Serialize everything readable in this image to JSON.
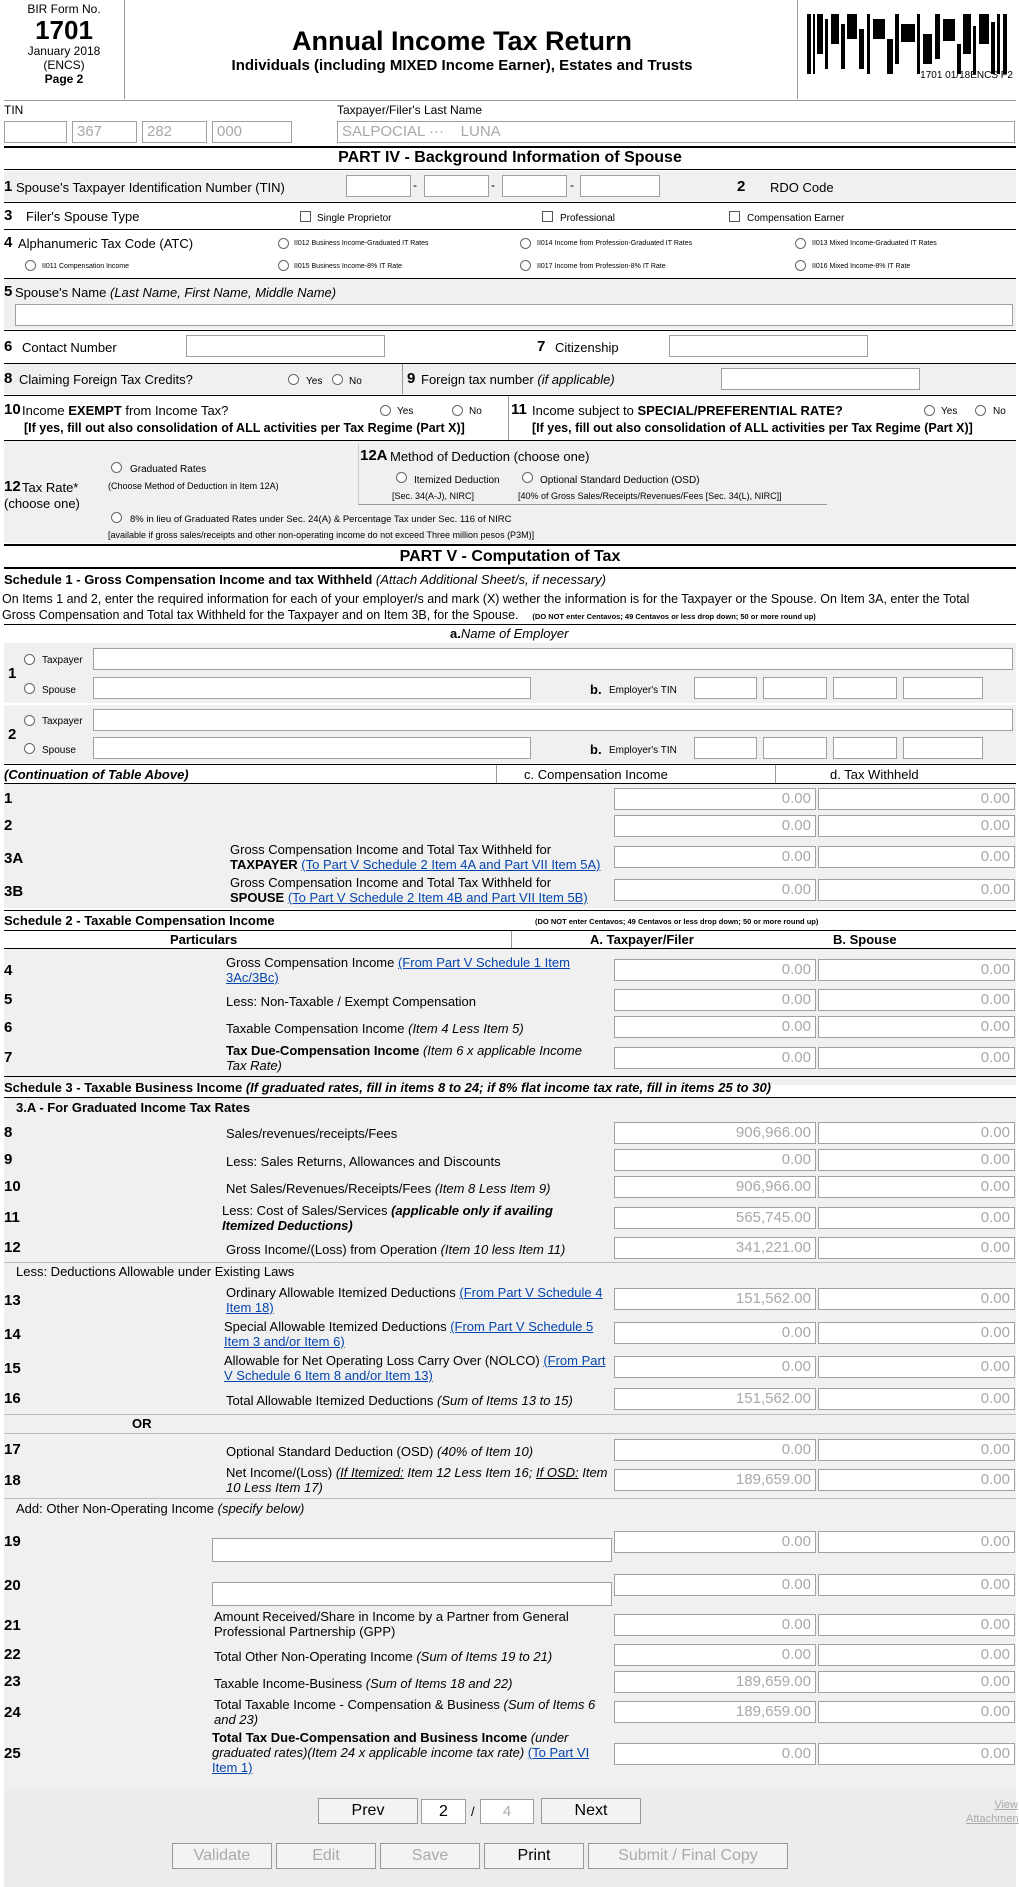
{
  "header": {
    "bir_form_no_label": "BIR Form No.",
    "form_number": "1701",
    "form_date": "January 2018",
    "form_encs": "(ENCS)",
    "page_label": "Page 2",
    "title": "Annual Income Tax Return",
    "subtitle": "Individuals (including MIXED Income Earner), Estates and Trusts",
    "barcode_text": "1701 01/18ENCS P2"
  },
  "tin_row": {
    "tin_label": "TIN",
    "tin_parts": [
      "",
      "367",
      "282",
      "000"
    ],
    "lastname_label": "Taxpayer/Filer's Last Name",
    "lastname_value": "SALPOCIAL ···    LUNA"
  },
  "part4": {
    "title": "PART IV - Background Information of Spouse",
    "item1_num": "1",
    "item1_label": "Spouse's Taxpayer Identification Number (TIN)",
    "item2_num": "2",
    "item2_label": "RDO Code",
    "item3_num": "3",
    "item3_label": "Filer's Spouse Type",
    "spouse_types": [
      "Single Proprietor",
      "Professional",
      "Compensation Earner"
    ],
    "item4_num": "4",
    "item4_label": "Alphanumeric Tax Code (ATC)",
    "atc_options": [
      "II012 Business Income-Graduated IT Rates",
      "II014 Income from Profession-Graduated IT Rates",
      "II013 Mixed Income-Graduated IT Rates",
      "II011 Compensation Income",
      "II015 Business Income-8% IT Rate",
      "II017 Income from Profession-8% IT Rate",
      "II016 Mixed Income-8% IT Rate"
    ],
    "item5_num": "5",
    "item5_label": "Spouse's Name",
    "item5_hint": "(Last Name, First Name, Middle Name)",
    "item6_num": "6",
    "item6_label": "Contact Number",
    "item7_num": "7",
    "item7_label": "Citizenship",
    "item8_num": "8",
    "item8_label": "Claiming Foreign Tax Credits?",
    "yes_label": "Yes",
    "no_label": "No",
    "item9_num": "9",
    "item9_label": "Foreign tax number",
    "item9_hint": "(if applicable)",
    "item10_num": "10",
    "item10_label_a": "Income ",
    "item10_label_b": "EXEMPT",
    "item10_label_c": " from Income Tax?",
    "item10_note": "[If yes, fill out also consolidation of ALL activities per Tax Regime (Part X)]",
    "item11_num": "11",
    "item11_label_a": "Income subject to ",
    "item11_label_b": "SPECIAL/PREFERENTIAL RATE?",
    "item11_note": "[If yes, fill out also consolidation of ALL activities per Tax Regime (Part X)]",
    "item12_num": "12",
    "item12_label": "Tax Rate*",
    "item12_choose": "(choose one)",
    "graduated_label": "Graduated Rates",
    "graduated_note": "(Choose Method of Deduction in Item 12A)",
    "eight_label": "8% in lieu of Graduated Rates under Sec. 24(A) & Percentage Tax under Sec. 116 of NIRC",
    "eight_note": "[available if gross sales/receipts and other non-operating income do not exceed Three million pesos (P3M)]",
    "item12a_num": "12A",
    "item12a_label": "Method of Deduction (choose one)",
    "itemized_label": "Itemized Deduction",
    "itemized_note": "[Sec. 34(A-J), NIRC]",
    "osd_label": "Optional Standard Deduction (OSD)",
    "osd_note": "[40% of Gross Sales/Receipts/Revenues/Fees [Sec. 34(L), NIRC]]"
  },
  "part5": {
    "title": "PART V - Computation of Tax",
    "sched1_title": "Schedule 1 - Gross Compensation Income and tax Withheld",
    "sched1_hint": "(Attach Additional Sheet/s, if necessary)",
    "sched1_instr": "On Items 1 and 2, enter the required information for each of your employer/s and mark (X) wether the information is for the Taxpayer or the Spouse. On Item 3A, enter the Total Gross Compensation and Total tax Withheld for the Taxpayer and on Item 3B, for the Spouse.",
    "sched1_centavos": "(DO NOT enter Centavos; 49 Centavos or less drop down; 50 or more round up)",
    "col_a_prefix": "a.",
    "col_a_label": "Name of Employer",
    "taxpayer_label": "Taxpayer",
    "spouse_label": "Spouse",
    "b_prefix": "b.",
    "employer_tin_label": "Employer's TIN",
    "cont_label": "(Continuation of Table Above)",
    "col_c_label": "c. Compensation Income",
    "col_d_label": "d. Tax Withheld",
    "s1_rows": [
      {
        "num": "1",
        "label": "",
        "c": "0.00",
        "d": "0.00"
      },
      {
        "num": "2",
        "label": "",
        "c": "0.00",
        "d": "0.00"
      },
      {
        "num": "3A",
        "label": "Gross Compensation Income and Total Tax Withheld for",
        "label2": "TAXPAYER",
        "link": "(To Part V Schedule 2 Item 4A and Part VII Item 5A)",
        "c": "0.00",
        "d": "0.00"
      },
      {
        "num": "3B",
        "label": "Gross Compensation Income and Total Tax Withheld for",
        "label2": "SPOUSE",
        "link": "(To Part V Schedule 2 Item 4B and Part VII Item 5B)",
        "c": "0.00",
        "d": "0.00"
      }
    ],
    "sched2_title": "Schedule 2 - Taxable Compensation Income",
    "sched2_centavos": "(DO NOT enter Centavos; 49 Centavos or less drop down; 50 or more round up)",
    "particulars_label": "Particulars",
    "col_taxpayer_label": "A. Taxpayer/Filer",
    "col_spouse_label": "B. Spouse",
    "s2_rows": [
      {
        "num": "4",
        "label": "Gross Compensation Income ",
        "link": "(From Part V Schedule 1 Item 3Ac/3Bc)",
        "a": "0.00",
        "b": "0.00"
      },
      {
        "num": "5",
        "label": "Less: Non-Taxable / Exempt Compensation",
        "a": "0.00",
        "b": "0.00"
      },
      {
        "num": "6",
        "label": "Taxable Compensation Income ",
        "italic": "(Item 4 Less Item 5)",
        "a": "0.00",
        "b": "0.00"
      },
      {
        "num": "7",
        "bold": "Tax Due-Compensation Income ",
        "italic": "(Item 6 x applicable Income Tax Rate)",
        "a": "0.00",
        "b": "0.00"
      }
    ],
    "sched3_title": "Schedule 3 - Taxable Business Income",
    "sched3_hint": "(If graduated rates, fill in items 8 to 24; if 8% flat income tax rate, fill in items 25 to 30)",
    "sched3a_title": "3.A - For Graduated Income Tax Rates",
    "s3_rows": [
      {
        "num": "8",
        "label": "Sales/revenues/receipts/Fees",
        "a": "906,966.00",
        "b": "0.00"
      },
      {
        "num": "9",
        "label": "Less: Sales Returns, Allowances and Discounts",
        "a": "0.00",
        "b": "0.00"
      },
      {
        "num": "10",
        "label": "Net Sales/Revenues/Receipts/Fees ",
        "italic": "(Item 8 Less Item 9)",
        "a": "906,966.00",
        "b": "0.00"
      },
      {
        "num": "11",
        "label": "Less: Cost of Sales/Services ",
        "bolditalic": "(applicable only if availing Itemized Deductions)",
        "a": "565,745.00",
        "b": "0.00"
      },
      {
        "num": "12",
        "label": "Gross Income/(Loss) from Operation ",
        "italic": "(Item 10 less Item 11)",
        "a": "341,221.00",
        "b": "0.00"
      }
    ],
    "deductions_label": "Less: Deductions Allowable under Existing Laws",
    "s3b_rows": [
      {
        "num": "13",
        "label": "Ordinary Allowable Itemized Deductions ",
        "link": "(From Part V Schedule 4 Item 18)",
        "a": "151,562.00",
        "b": "0.00"
      },
      {
        "num": "14",
        "label": "Special Allowable Itemized Deductions ",
        "link": "(From Part V Schedule 5 Item 3 and/or Item 6)",
        "a": "0.00",
        "b": "0.00"
      },
      {
        "num": "15",
        "label": "Allowable for Net Operating Loss Carry Over (NOLCO) ",
        "link": "(From Part V Schedule 6 Item 8 and/or Item 13)",
        "a": "0.00",
        "b": "0.00"
      },
      {
        "num": "16",
        "label": "Total Allowable Itemized Deductions ",
        "italic": "(Sum of Items 13 to 15)",
        "a": "151,562.00",
        "b": "0.00"
      }
    ],
    "or_label": "OR",
    "s3c_rows": [
      {
        "num": "17",
        "label": "Optional Standard Deduction (OSD) ",
        "italic": "(40% of Item 10)",
        "a": "0.00",
        "b": "0.00"
      },
      {
        "num": "18",
        "label": "Net Income/(Loss) ",
        "u1": "(If Itemized:",
        "mid": " Item 12 Less Item 16; ",
        "u2": "If OSD:",
        "end": " Item 10 Less Item 17)",
        "a": "189,659.00",
        "b": "0.00"
      }
    ],
    "other_income_label": "Add: Other Non-Operating Income ",
    "other_income_hint": "(specify below)",
    "s3d_rows": [
      {
        "num": "19",
        "a": "0.00",
        "b": "0.00"
      },
      {
        "num": "20",
        "a": "0.00",
        "b": "0.00"
      },
      {
        "num": "21",
        "label": "Amount Received/Share in Income by a Partner from General Professional Partnership (GPP)",
        "a": "0.00",
        "b": "0.00"
      },
      {
        "num": "22",
        "label": "Total Other Non-Operating Income ",
        "italic": "(Sum of Items 19 to 21)",
        "a": "0.00",
        "b": "0.00"
      },
      {
        "num": "23",
        "label": "Taxable Income-Business ",
        "italic": "(Sum of Items 18 and 22)",
        "a": "189,659.00",
        "b": "0.00"
      },
      {
        "num": "24",
        "label": "Total Taxable Income - Compensation & Business ",
        "italic": "(Sum of Items 6 and 23)",
        "a": "189,659.00",
        "b": "0.00"
      },
      {
        "num": "25",
        "bold": "Total Tax Due-Compensation and Business Income ",
        "italic": "(under graduated rates)(Item 24 x applicable income tax rate) ",
        "link": "(To Part VI Item 1)",
        "a": "0.00",
        "b": "0.00"
      }
    ]
  },
  "nav": {
    "prev": "Prev",
    "page_current": "2",
    "page_sep": "/",
    "page_total": "4",
    "next": "Next",
    "view_attachments": "View Attachments",
    "validate": "Validate",
    "edit": "Edit",
    "save": "Save",
    "print": "Print",
    "submit": "Submit / Final Copy"
  }
}
